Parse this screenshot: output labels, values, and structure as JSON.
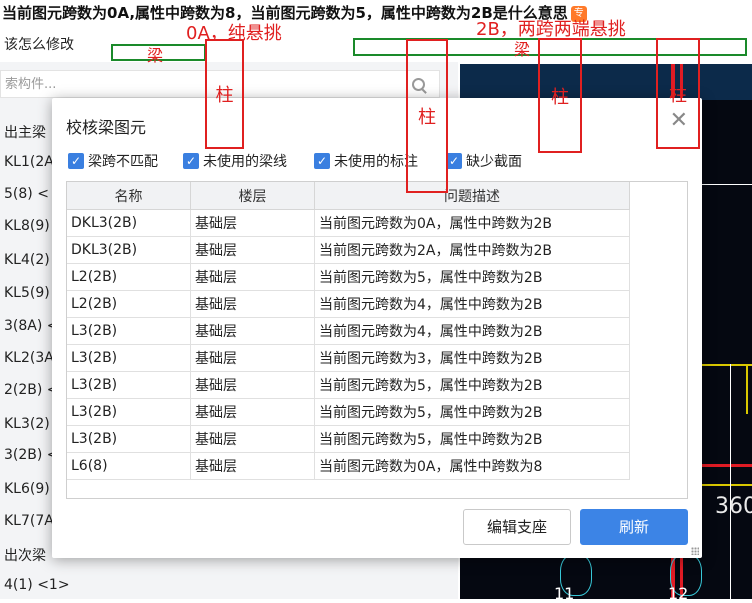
{
  "question": {
    "title": "当前图元跨数为0A,属性中跨数为8，当前图元跨数为5，属性中跨数为2B是什么意思",
    "badge": "专",
    "subtitle": "该怎么修改"
  },
  "annotations": {
    "text_0a": "0A，纯悬挑",
    "text_2b": "2B，两跨两端悬挑",
    "beam_left": "梁",
    "beam_right": "梁",
    "columns": [
      "柱",
      "柱",
      "柱",
      "柱"
    ]
  },
  "left_panel": {
    "search_placeholder": "索构件...",
    "items": [
      "出主梁",
      "KL1(2A",
      "5(8) <",
      "KL8(9)",
      "KL4(2)",
      "KL5(9)",
      "3(8A) <",
      "KL2(3A",
      "2(2B) <",
      "KL3(2)",
      "3(2B) <",
      "KL6(9)",
      "KL7(7A",
      "出次梁",
      "4(1) <1>"
    ]
  },
  "cad": {
    "number": "360",
    "bottom_labels": [
      "11",
      "12"
    ]
  },
  "dialog": {
    "title": "校核梁图元",
    "close_glyph": "✕",
    "checkboxes": [
      {
        "label": "梁跨不匹配",
        "checked": true
      },
      {
        "label": "未使用的梁线",
        "checked": true
      },
      {
        "label": "未使用的标注",
        "checked": true
      },
      {
        "label": "缺少截面",
        "checked": true
      }
    ],
    "table": {
      "columns": [
        "名称",
        "楼层",
        "问题描述"
      ],
      "rows": [
        [
          "DKL3(2B)",
          "基础层",
          "当前图元跨数为0A，属性中跨数为2B"
        ],
        [
          "DKL3(2B)",
          "基础层",
          "当前图元跨数为2A，属性中跨数为2B"
        ],
        [
          "L2(2B)",
          "基础层",
          "当前图元跨数为5，属性中跨数为2B"
        ],
        [
          "L2(2B)",
          "基础层",
          "当前图元跨数为4，属性中跨数为2B"
        ],
        [
          "L3(2B)",
          "基础层",
          "当前图元跨数为4，属性中跨数为2B"
        ],
        [
          "L3(2B)",
          "基础层",
          "当前图元跨数为3，属性中跨数为2B"
        ],
        [
          "L3(2B)",
          "基础层",
          "当前图元跨数为5，属性中跨数为2B"
        ],
        [
          "L3(2B)",
          "基础层",
          "当前图元跨数为5，属性中跨数为2B"
        ],
        [
          "L3(2B)",
          "基础层",
          "当前图元跨数为5，属性中跨数为2B"
        ],
        [
          "L6(8)",
          "基础层",
          "当前图元跨数为0A，属性中跨数为8"
        ]
      ]
    },
    "buttons": {
      "edit_support": "编辑支座",
      "refresh": "刷新"
    }
  }
}
